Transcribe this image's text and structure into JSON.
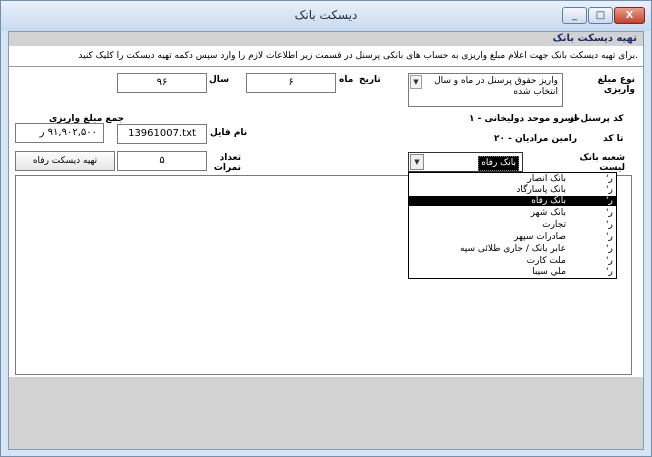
{
  "window": {
    "title": "دیسکت بانک",
    "minimize_glyph": "_",
    "maximize_glyph": "□",
    "close_glyph": "X"
  },
  "form": {
    "header": "تهیه دیسکت بانک",
    "note": "برای تهیه دیسکت بانک جهت اعلام مبلغ واریزی به حساب های بانکی پرسنل در قسمت زیر اطلاعات لازم را وارد سپس دکمه تهیه دیسکت را کلیک کنید."
  },
  "fields": {
    "payment_type_label": "نوع مبلغ واریزی",
    "payment_type_value": "واریز حقوق پرسنل در ماه و سال انتخاب شده",
    "date_label": "تاریخ",
    "month_label": "ماه",
    "month_value": "۶",
    "year_label": "سال",
    "year_value": "۹۶",
    "total_label": "جمع مبلغ واریزی",
    "total_value": "۹۱,۹۰۲,۵۰۰ ر",
    "file_name_label": "نام فایل",
    "file_name_value": "13961007.txt",
    "from_code_label": "کد پرسنل از",
    "from_code_value": "۱ - خسرو موحد دولیخانی",
    "to_code_label": "تا کد",
    "to_code_value": "۲۰ - رامین مرادیان",
    "records_label": "تعداد نمرات",
    "records_value": "۵",
    "make_button": "تهیه دیسکت رفاه",
    "branch_label": "شعبه بانک لیست پرسنل",
    "branch_value": "بانک رفاه"
  },
  "bank_options": [
    {
      "name": "بانک انصار",
      "code": "'ر"
    },
    {
      "name": "بانک پاسارگاد",
      "code": "'ر"
    },
    {
      "name": "بانک رفاه",
      "code": "'ر",
      "selected": true
    },
    {
      "name": "بانک شهر",
      "code": "'ر"
    },
    {
      "name": "تجارت",
      "code": "'ر"
    },
    {
      "name": "صادرات سپهر",
      "code": "'ر"
    },
    {
      "name": "عابر بانک / جاری طلائی سپه",
      "code": "'ر"
    },
    {
      "name": "ملت کارت",
      "code": "'ر"
    },
    {
      "name": "ملي سيبا",
      "code": "'ر"
    }
  ]
}
